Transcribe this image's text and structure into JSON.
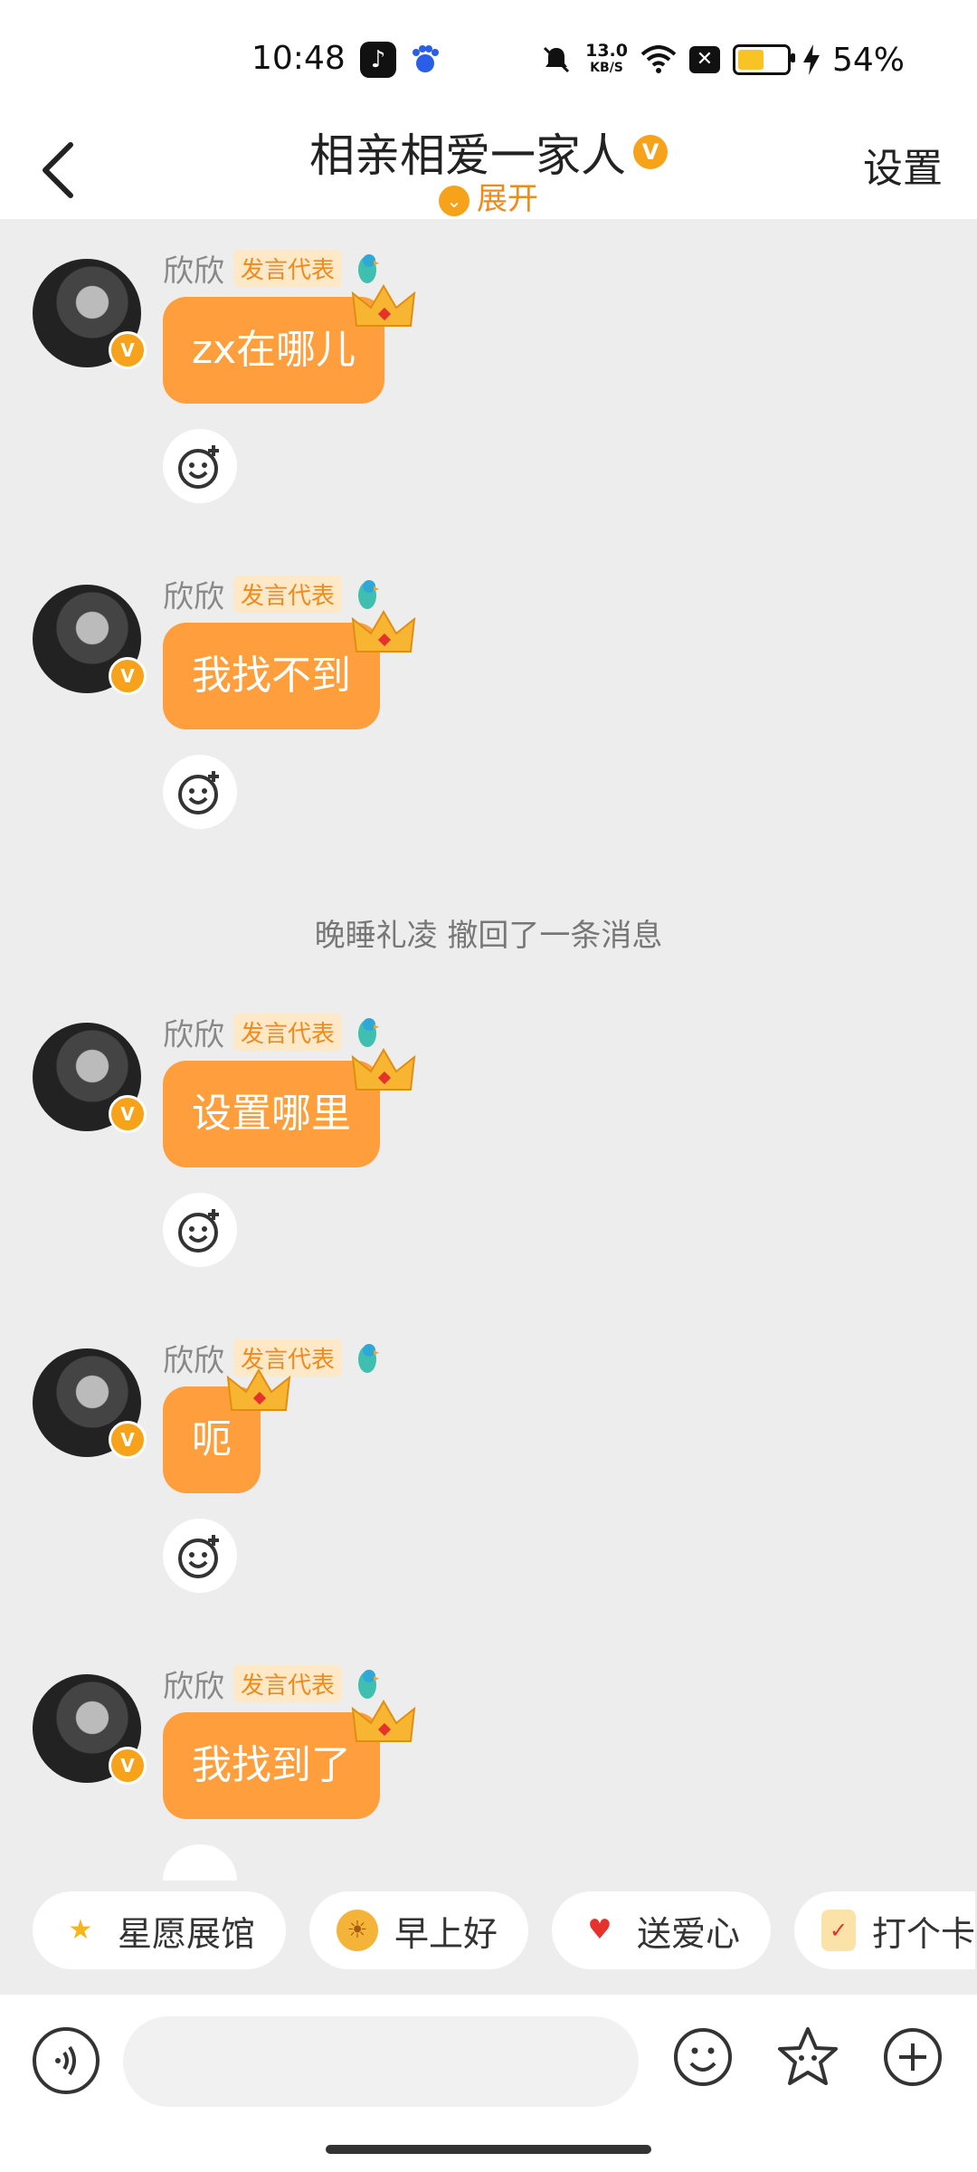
{
  "status_bar": {
    "time": "10:48",
    "net_speed_value": "13.0",
    "net_speed_unit": "KB/S",
    "battery_percent": "54%",
    "battery_level": 0.54
  },
  "header": {
    "title": "相亲相爱一家人",
    "expand_label": "展开",
    "settings_label": "设置"
  },
  "messages": [
    {
      "name": "欣欣",
      "role": "发言代表",
      "text": "zx在哪儿"
    },
    {
      "name": "欣欣",
      "role": "发言代表",
      "text": "我找不到"
    },
    {
      "name": "欣欣",
      "role": "发言代表",
      "text": "设置哪里"
    },
    {
      "name": "欣欣",
      "role": "发言代表",
      "text": "呃"
    },
    {
      "name": "欣欣",
      "role": "发言代表",
      "text": "我找到了"
    }
  ],
  "recall_notice": "晚睡礼凌 撤回了一条消息",
  "quick_chips": [
    {
      "label": "星愿展馆",
      "icon": "star-icon"
    },
    {
      "label": "早上好",
      "icon": "sun-face-icon"
    },
    {
      "label": "送爱心",
      "icon": "heart-icon"
    },
    {
      "label": "打个卡",
      "icon": "checkin-icon"
    }
  ],
  "input": {
    "placeholder": ""
  },
  "colors": {
    "accent": "#ff9e3d",
    "background": "#ededed",
    "badge": "#f7a21b"
  }
}
